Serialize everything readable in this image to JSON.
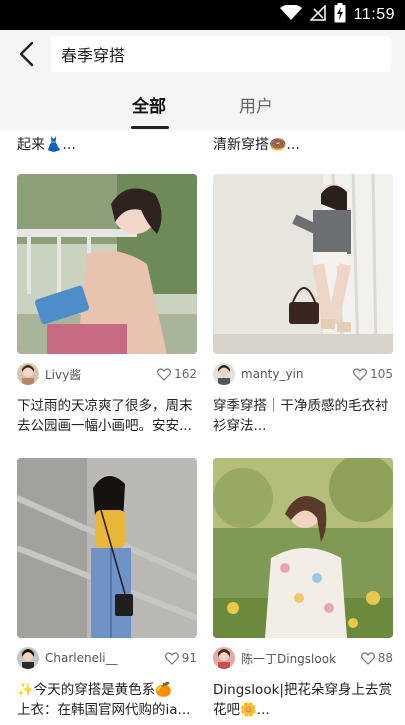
{
  "status_bar": {
    "time": "11:59"
  },
  "search": {
    "query": "春季穿搭"
  },
  "tabs": [
    {
      "label": "全部",
      "active": true
    },
    {
      "label": "用户",
      "active": false
    }
  ],
  "partial_cards": [
    {
      "text": "起来👗..."
    },
    {
      "text": "清新穿搭🍩..."
    }
  ],
  "cards": [
    {
      "user": "Livy酱",
      "likes": "162",
      "desc_line1": "下过雨的天凉爽了很多，周末",
      "desc_line2": "去公园画一幅小画吧。安安..."
    },
    {
      "user": "manty_yin",
      "likes": "105",
      "desc_line1": "穿季穿搭｜干净质感的毛衣衬",
      "desc_line2": "衫穿法..."
    },
    {
      "user": "Charleneli__",
      "likes": "91",
      "desc_line1": "✨今天的穿搭是黄色系🍊",
      "desc_line2": "上衣：在韩国官网代购的ia..."
    },
    {
      "user": "陈一丁Dingslook",
      "likes": "88",
      "desc_line1": "Dingslook|把花朵穿身上去赏",
      "desc_line2": "花吧🌼..."
    }
  ],
  "colors": {
    "accent": "#222222",
    "header_bg": "#f5f5f5",
    "statusbar_bg": "#000000"
  }
}
